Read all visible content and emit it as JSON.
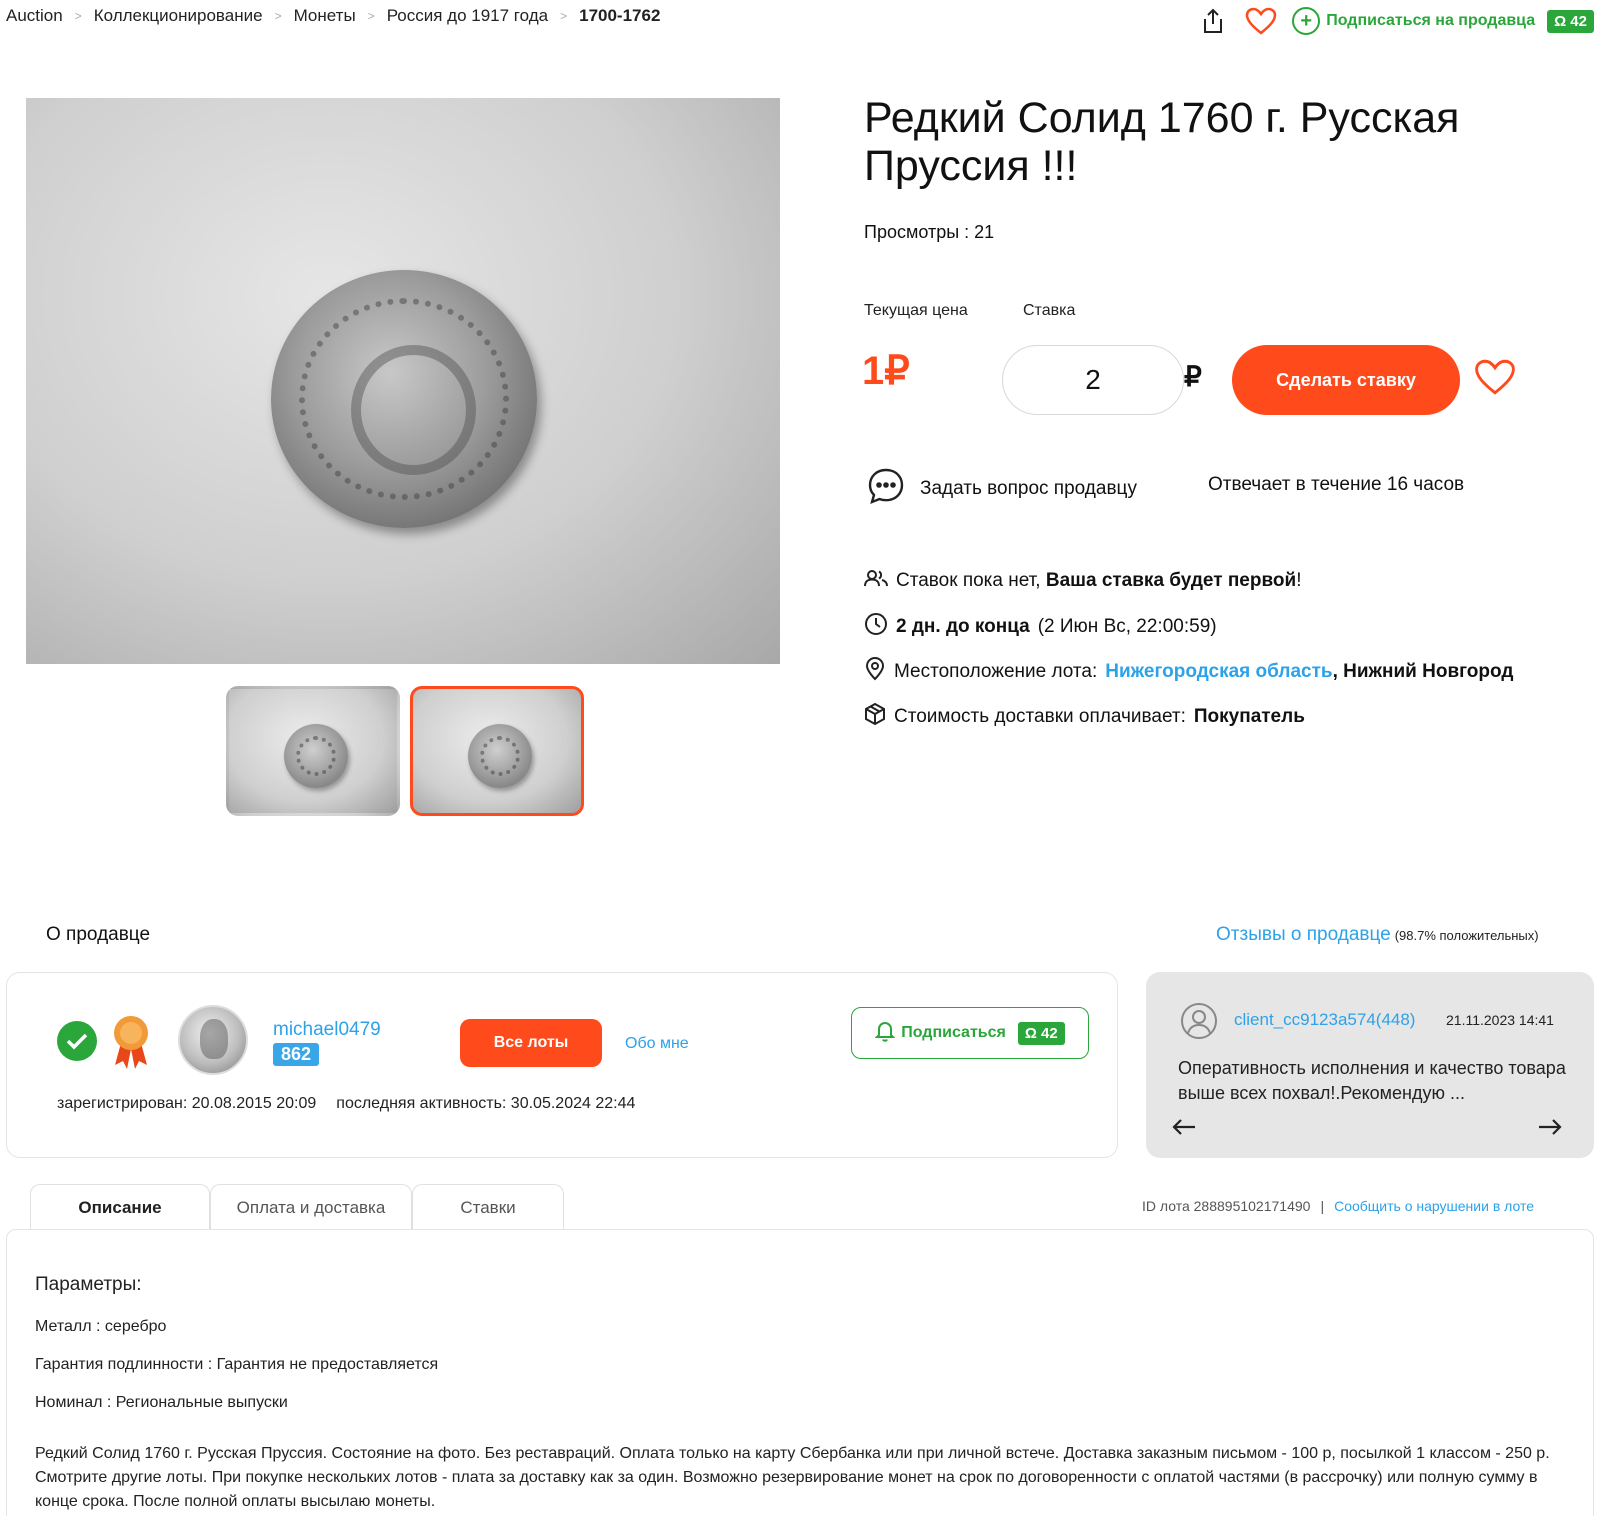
{
  "breadcrumb": {
    "items": [
      "Auction",
      "Коллекционирование",
      "Монеты",
      "Россия до 1917 года"
    ],
    "current": "1700-1762"
  },
  "top_actions": {
    "subscribe_label": "Подписаться на продавца",
    "subscribers": "Ω 42"
  },
  "lot": {
    "title": "Редкий Солид 1760 г. Русская Пруссия !!!",
    "views": "Просмотры : 21",
    "current_price_label": "Текущая цена",
    "bid_label": "Ставка",
    "price": "1₽",
    "bid_value": "2",
    "currency": "₽",
    "bid_button": "Сделать ставку",
    "ask_seller": "Задать вопрос продавцу",
    "reply_time": "Отвечает в течение 16 часов",
    "bids_prefix": "Ставок пока нет, ",
    "bids_bold": "Ваша ставка будет первой",
    "bids_suffix": "!",
    "time_bold": "2 дн. до конца",
    "time_rest": "(2 Июн Вс, 22:00:59)",
    "location_label": "Местоположение лота:",
    "location_region": "Нижегородская область",
    "location_city": ", Нижний Новгород",
    "delivery_label": "Стоимость доставки оплачивает:",
    "delivery_payer": "Покупатель"
  },
  "seller": {
    "section_title": "О продавце",
    "reviews_link": "Отзывы о продавце",
    "reviews_percent": "(98.7% положительных)",
    "name": "michael0479",
    "rating": "862",
    "all_lots": "Все лоты",
    "about_me": "Обо мне",
    "subscribe": "Подписаться",
    "subscribers": "Ω 42",
    "registered": "зарегистрирован: 20.08.2015 20:09",
    "last_activity": "последняя активность: 30.05.2024 22:44"
  },
  "review": {
    "user": "client_cc9123a574(448)",
    "date": "21.11.2023 14:41",
    "text": "Оперативность исполнения и качество товара выше всех похвал!.Рекомендую ..."
  },
  "tabs": [
    "Описание",
    "Оплата и доставка",
    "Ставки"
  ],
  "lot_meta": {
    "id": "ID лота 288895102171490",
    "separator": "|",
    "report": "Сообщить о нарушении в лоте"
  },
  "description": {
    "params_title": "Параметры:",
    "params": [
      "Металл : серебро",
      "Гарантия подлинности : Гарантия не предоставляется",
      "Номинал : Региональные выпуски"
    ],
    "text": "Редкий Солид 1760 г. Русская Пруссия. Состояние на фото. Без реставраций. Оплата только на карту Сбербанка или при личной встече. Доставка заказным письмом - 100 р, посылкой 1 классом - 250 р. Смотрите другие лоты. При покупке нескольких лотов - плата за доставку как за один. Возможно резервирование монет на срок по договоренности с оплатой частями (в рассрочку) или полную сумму в конце срока. После полной оплаты высылаю монеты."
  },
  "colors": {
    "accent": "#ff4a1c",
    "green": "#2aa63a",
    "link": "#2ca2e8"
  }
}
